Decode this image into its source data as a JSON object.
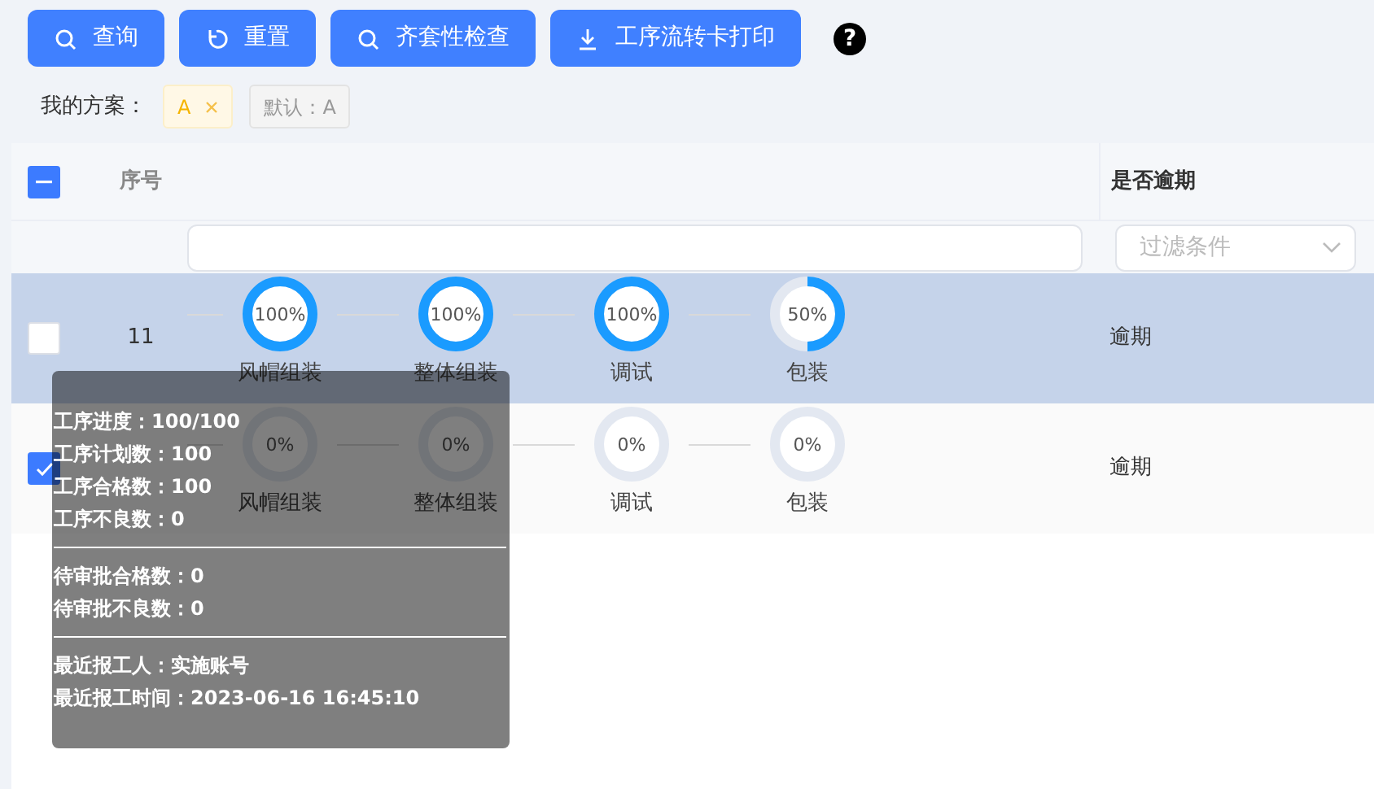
{
  "toolbar": {
    "buttons": [
      {
        "label": "查询",
        "kind": "search"
      },
      {
        "label": "重置",
        "kind": "reset"
      },
      {
        "label": "齐套性检查",
        "kind": "search"
      },
      {
        "label": "工序流转卡打印",
        "kind": "download"
      }
    ],
    "help": "?"
  },
  "schemes": {
    "label": "我的方案：",
    "tags": [
      {
        "label": "A",
        "kind": "active",
        "closable": true
      },
      {
        "label": "默认：A",
        "kind": "default",
        "closable": false
      }
    ]
  },
  "table": {
    "header_checkbox": {
      "indeterminate": true
    },
    "columns": [
      {
        "label": "序号"
      },
      {},
      {
        "label": "是否逾期"
      }
    ],
    "filters": {
      "overdue": {
        "placeholder": "过滤条件"
      }
    },
    "rows": [
      {
        "selected": true,
        "checked": false,
        "index": "11",
        "overdue": "逾期",
        "steps": [
          {
            "name": "风帽组装",
            "percent": "100%",
            "level": 1
          },
          {
            "name": "整体组装",
            "percent": "100%",
            "level": 1
          },
          {
            "name": "调试",
            "percent": "100%",
            "level": 1
          },
          {
            "name": "包装",
            "percent": "50%",
            "level": 0.5
          }
        ]
      },
      {
        "selected": false,
        "checked": true,
        "overdue": "逾期",
        "steps": [
          {
            "name": "风帽组装",
            "percent": "0%",
            "level": 0
          },
          {
            "name": "整体组装",
            "percent": "0%",
            "level": 0
          },
          {
            "name": "调试",
            "percent": "0%",
            "level": 0
          },
          {
            "name": "包装",
            "percent": "0%",
            "level": 0
          }
        ]
      }
    ]
  },
  "tooltip": {
    "sections": [
      [
        "工序进度：100/100",
        "工序计划数：100",
        "工序合格数：100",
        "工序不良数：0"
      ],
      [
        "待审批合格数：0",
        "待审批不良数：0"
      ],
      [
        "最近报工人：实施账号",
        "最近报工时间：2023-06-16 16:45:10"
      ]
    ]
  }
}
